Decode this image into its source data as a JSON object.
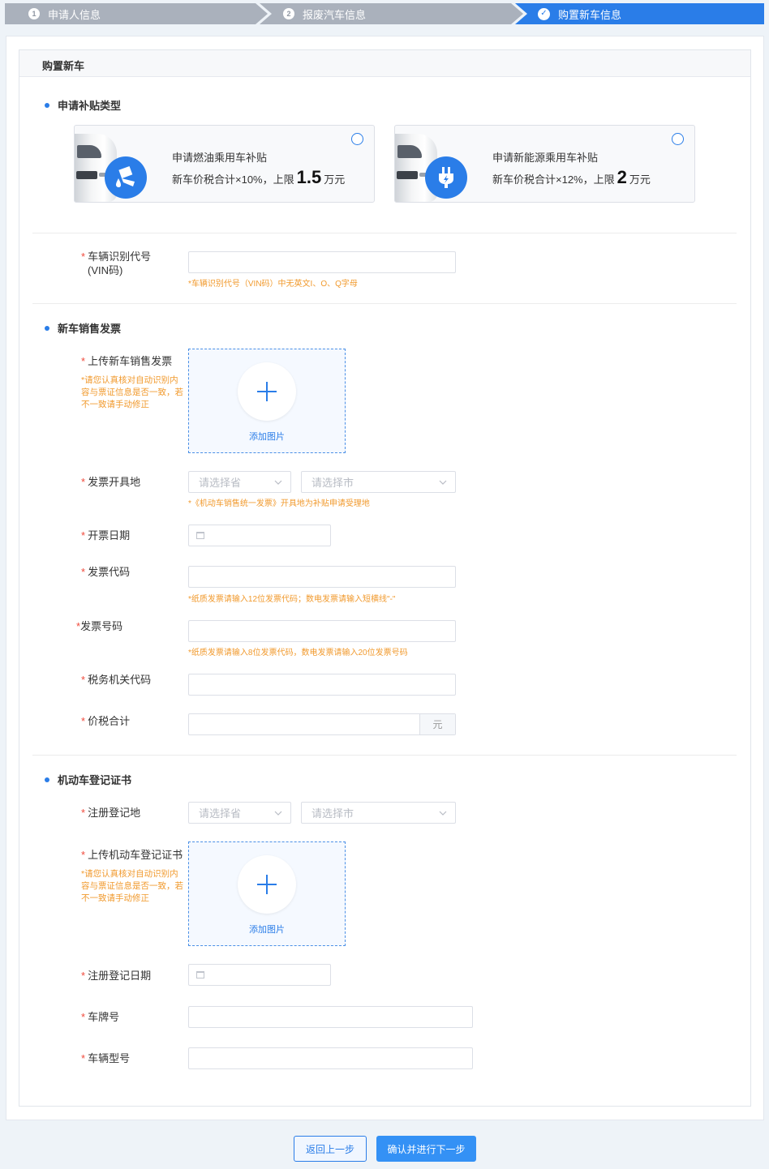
{
  "steps": [
    {
      "num": "1",
      "label": "申请人信息"
    },
    {
      "num": "2",
      "label": "报废汽车信息"
    },
    {
      "num": "✓",
      "label": "购置新车信息"
    }
  ],
  "panel_title": "购置新车",
  "subsidy": {
    "section_title": "申请补贴类型",
    "cards": [
      {
        "title": "申请燃油乘用车补贴",
        "desc_prefix": "新车价税合计×10%，上限",
        "amount": "1.5",
        "unit": "万元",
        "icon": "fuel-pump-icon"
      },
      {
        "title": "申请新能源乘用车补贴",
        "desc_prefix": "新车价税合计×12%，上限",
        "amount": "2",
        "unit": "万元",
        "icon": "electric-plug-icon"
      }
    ]
  },
  "vin": {
    "label_line1": "车辆识别代号",
    "label_line2": "(VIN码)",
    "hint": "*车辆识别代号（VIN码）中无英文I、O、Q字母"
  },
  "invoice": {
    "section_title": "新车销售发票",
    "upload_label": "上传新车销售发票",
    "upload_note": "*请您认真核对自动识别内容与票证信息是否一致，若不一致请手动修正",
    "upload_text": "添加图片",
    "place_label": "发票开具地",
    "province_placeholder": "请选择省",
    "city_placeholder": "请选择市",
    "place_hint": "*《机动车销售统一发票》开具地为补贴申请受理地",
    "date_label": "开票日期",
    "code_label": "发票代码",
    "code_hint": "*纸质发票请输入12位发票代码；数电发票请输入短横线\"-\"",
    "number_label": "发票号码",
    "number_hint": "*纸质发票请输入8位发票代码，数电发票请输入20位发票号码",
    "tax_office_label": "税务机关代码",
    "total_label": "价税合计",
    "total_suffix": "元"
  },
  "registration": {
    "section_title": "机动车登记证书",
    "place_label": "注册登记地",
    "province_placeholder": "请选择省",
    "city_placeholder": "请选择市",
    "upload_label": "上传机动车登记证书",
    "upload_note": "*请您认真核对自动识别内容与票证信息是否一致，若不一致请手动修正",
    "upload_text": "添加图片",
    "date_label": "注册登记日期",
    "plate_label": "车牌号",
    "model_label": "车辆型号"
  },
  "required_mark": "*",
  "buttons": {
    "back": "返回上一步",
    "next": "确认并进行下一步"
  }
}
